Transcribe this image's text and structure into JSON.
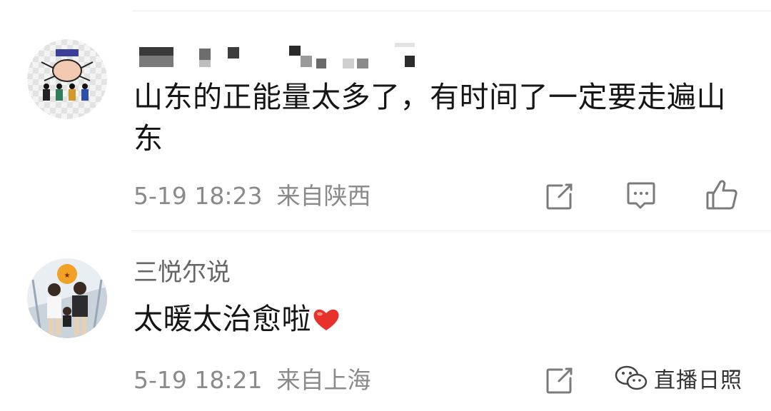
{
  "comments": [
    {
      "username": "",
      "text": "山东的正能量太多了，有时间了一定要走遍山东",
      "date": "5-19 18:23",
      "location": "来自陕西"
    },
    {
      "username": "三悦尔说",
      "text": "太暖太治愈啦",
      "emoji_name": "red-heart",
      "date": "5-19 18:21",
      "location": "来自上海"
    }
  ],
  "icons": {
    "share": "share-icon",
    "comment": "comment-icon",
    "like": "like-icon",
    "watermark": "wechat-icon"
  },
  "watermark": {
    "text": "直播日照"
  },
  "colors": {
    "text_primary": "#151515",
    "text_secondary": "#8a8a8a",
    "username": "#666666",
    "divider": "#ececec",
    "heart": "#e8312c"
  }
}
